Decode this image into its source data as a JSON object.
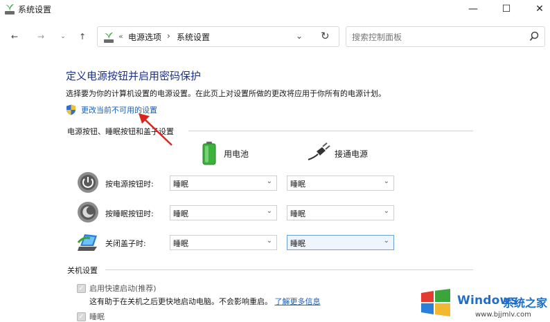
{
  "window": {
    "title": "系统设置",
    "minimize_glyph": "—",
    "maximize_glyph": "☐",
    "close_glyph": "✕"
  },
  "toolbar": {
    "back_glyph": "←",
    "forward_glyph": "→",
    "recent_glyph": "⌄",
    "up_glyph": "↑",
    "address_sep": "«",
    "breadcrumb": [
      "电源选项",
      "系统设置"
    ],
    "crumb_arrow": "›",
    "dropdown_glyph": "⌄",
    "refresh_glyph": "↻",
    "search_placeholder": "搜索控制面板"
  },
  "content": {
    "title": "定义电源按钮并启用密码保护",
    "description": "选择要为你的计算机设置的电源设置。在此页上对设置所做的更改将应用于你所有的电源计划。",
    "change_link": "更改当前不可用的设置",
    "section_buttons_title": "电源按钮、睡眠按钮和盖子设置",
    "battery_label": "用电池",
    "plugged_label": "接通电源",
    "rows": [
      {
        "label": "按电源按钮时:",
        "battery": "睡眠",
        "plugged": "睡眠"
      },
      {
        "label": "按睡眠按钮时:",
        "battery": "睡眠",
        "plugged": "睡眠"
      },
      {
        "label": "关闭盖子时:",
        "battery": "睡眠",
        "plugged": "睡眠"
      }
    ],
    "select_chevron": "⌄",
    "section_shutdown_title": "关机设置",
    "fast_startup_label": "启用快速启动(推荐)",
    "fast_startup_desc": "这有助于在关机之后更快地启动电脑。不会影响重启。",
    "learn_more": "了解更多信息",
    "sleep_label": "睡眠",
    "checkmark": "✓"
  },
  "watermark": {
    "brand": "Windows",
    "brand_cn": "系统之家",
    "url": "www.bjjmlv.com"
  },
  "colors": {
    "title_blue": "#1e3287",
    "link_blue": "#1a5fb4",
    "annotation_red": "#d9261c"
  },
  "icons": {
    "app": "power-options-plant-icon",
    "shield": "uac-shield-icon",
    "battery": "battery-icon",
    "plug": "power-plug-icon",
    "power_button": "power-button-icon",
    "sleep_button": "sleep-button-icon",
    "lid": "laptop-lid-icon",
    "search": "search-icon"
  }
}
